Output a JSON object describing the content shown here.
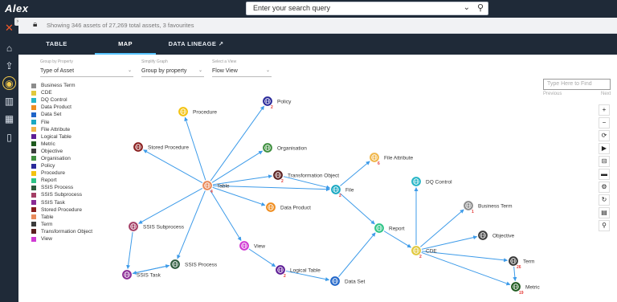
{
  "app": {
    "logo": "Alex"
  },
  "search": {
    "placeholder": "Enter your search query"
  },
  "info": {
    "text": "Showing 346 assets of 27,269 total assets, 3 favourites"
  },
  "tabs": [
    {
      "label": "TABLE"
    },
    {
      "label": "MAP"
    },
    {
      "label": "DATA LINEAGE ↗"
    }
  ],
  "controls": {
    "group": {
      "label": "Group by Property",
      "value": "Type of Asset"
    },
    "simplify": {
      "label": "Simplify Graph",
      "value": "Group by property"
    },
    "view": {
      "label": "Select a View",
      "value": "Flow View"
    }
  },
  "finder": {
    "placeholder": "Type Here to Find",
    "previous": "Previous",
    "next": "Next"
  },
  "legend": [
    {
      "label": "Business Term",
      "color": "#8c8c8c"
    },
    {
      "label": "CDE",
      "color": "#e0c83c"
    },
    {
      "label": "DQ Control",
      "color": "#26b5c6"
    },
    {
      "label": "Data Product",
      "color": "#ef8d1f"
    },
    {
      "label": "Data Set",
      "color": "#1e64c8"
    },
    {
      "label": "File",
      "color": "#19a8c2"
    },
    {
      "label": "File Attribute",
      "color": "#f0b64a"
    },
    {
      "label": "Logical Table",
      "color": "#5e1e96"
    },
    {
      "label": "Metric",
      "color": "#1e5a1e"
    },
    {
      "label": "Objective",
      "color": "#3d3d3d"
    },
    {
      "label": "Organisation",
      "color": "#3f8f3f"
    },
    {
      "label": "Policy",
      "color": "#2a2a9a"
    },
    {
      "label": "Procedure",
      "color": "#f3c20f"
    },
    {
      "label": "Report",
      "color": "#2ec486"
    },
    {
      "label": "SSIS Process",
      "color": "#2d5a3c"
    },
    {
      "label": "SSIS Subprocess",
      "color": "#a33d64"
    },
    {
      "label": "SSIS Task",
      "color": "#8a2a94"
    },
    {
      "label": "Stored Procedure",
      "color": "#8a1f1f"
    },
    {
      "label": "Table",
      "color": "#e98a5a"
    },
    {
      "label": "Term",
      "color": "#3a3a3a"
    },
    {
      "label": "Transformation Object",
      "color": "#5a1f1f"
    },
    {
      "label": "View",
      "color": "#d03ad3"
    }
  ],
  "tools": [
    {
      "glyph": "+",
      "name": "zoom-in-button"
    },
    {
      "glyph": "−",
      "name": "zoom-out-button"
    },
    {
      "glyph": "⟳",
      "name": "refresh-button"
    },
    {
      "glyph": "▶",
      "name": "play-button"
    },
    {
      "glyph": "⊟",
      "name": "save-layout-button"
    },
    {
      "glyph": "▬",
      "name": "folder-button"
    },
    {
      "glyph": "⚙",
      "name": "settings-button"
    },
    {
      "glyph": "↻",
      "name": "reset-button"
    },
    {
      "glyph": "▤",
      "name": "export-button"
    },
    {
      "glyph": "⚲",
      "name": "locate-button"
    }
  ],
  "graph": {
    "nodes": [
      {
        "id": "procedure",
        "label": "Procedure",
        "count": "",
        "color": "#f3c20f"
      },
      {
        "id": "policy",
        "label": "Policy",
        "count": "2",
        "color": "#2a2a9a"
      },
      {
        "id": "stored",
        "label": "Stored Procedure",
        "count": "",
        "color": "#8a1f1f"
      },
      {
        "id": "organisation",
        "label": "Organisation",
        "count": "",
        "color": "#3f8f3f"
      },
      {
        "id": "transform",
        "label": "Transformation Object",
        "count": "2",
        "color": "#5a1f1f"
      },
      {
        "id": "table",
        "label": "Table",
        "count": "4",
        "color": "#e98a5a"
      },
      {
        "id": "dataproduct",
        "label": "Data Product",
        "count": "",
        "color": "#ef8d1f"
      },
      {
        "id": "file",
        "label": "File",
        "count": "2",
        "color": "#19a8c2"
      },
      {
        "id": "fileattr",
        "label": "File Attribute",
        "count": "6",
        "color": "#f0b64a"
      },
      {
        "id": "dqcontrol",
        "label": "DQ Control",
        "count": "",
        "color": "#26b5c6"
      },
      {
        "id": "businessterm",
        "label": "Business Term",
        "count": "1",
        "color": "#8c8c8c"
      },
      {
        "id": "ssissub",
        "label": "SSIS Subprocess",
        "count": "",
        "color": "#a33d64"
      },
      {
        "id": "report",
        "label": "Report",
        "count": "",
        "color": "#2ec486"
      },
      {
        "id": "objective",
        "label": "Objective",
        "count": "",
        "color": "#3d3d3d"
      },
      {
        "id": "view",
        "label": "View",
        "count": "",
        "color": "#d03ad3"
      },
      {
        "id": "cde",
        "label": "CDE",
        "count": "2",
        "color": "#e0c83c"
      },
      {
        "id": "term",
        "label": "Term",
        "count": "26",
        "color": "#3a3a3a"
      },
      {
        "id": "ssisprocess",
        "label": "SSIS Process",
        "count": "",
        "color": "#2d5a3c"
      },
      {
        "id": "logical",
        "label": "Logical Table",
        "count": "2",
        "color": "#5e1e96"
      },
      {
        "id": "ssistask",
        "label": "SSIS Task",
        "count": "",
        "color": "#8a2a94"
      },
      {
        "id": "dataset",
        "label": "Data Set",
        "count": "",
        "color": "#1e64c8"
      },
      {
        "id": "metric",
        "label": "Metric",
        "count": "19",
        "color": "#1e5a1e"
      }
    ],
    "edges": [
      [
        "table",
        "procedure"
      ],
      [
        "table",
        "policy"
      ],
      [
        "table",
        "stored"
      ],
      [
        "table",
        "organisation"
      ],
      [
        "table",
        "transform"
      ],
      [
        "table",
        "dataproduct"
      ],
      [
        "table",
        "view"
      ],
      [
        "table",
        "ssissub"
      ],
      [
        "table",
        "ssisprocess"
      ],
      [
        "table",
        "file"
      ],
      [
        "transform",
        "file"
      ],
      [
        "file",
        "fileattr"
      ],
      [
        "file",
        "report"
      ],
      [
        "view",
        "logical"
      ],
      [
        "logical",
        "dataset"
      ],
      [
        "dataset",
        "report"
      ],
      [
        "report",
        "cde"
      ],
      [
        "cde",
        "dqcontrol"
      ],
      [
        "cde",
        "businessterm"
      ],
      [
        "cde",
        "objective"
      ],
      [
        "cde",
        "term"
      ],
      [
        "cde",
        "metric"
      ],
      [
        "term",
        "metric"
      ],
      [
        "ssissub",
        "ssistask"
      ],
      [
        "ssistask",
        "ssisprocess"
      ],
      [
        "ssisprocess",
        "ssistask"
      ]
    ]
  }
}
